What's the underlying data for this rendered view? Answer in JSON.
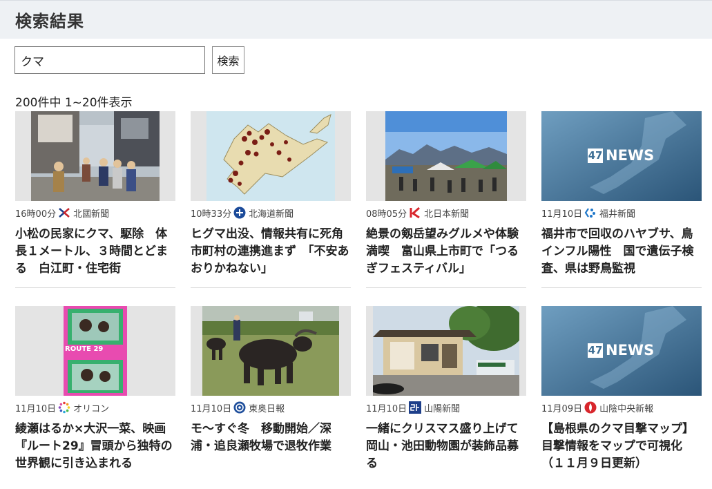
{
  "page": {
    "title": "検索結果"
  },
  "search": {
    "value": "クマ",
    "button_label": "検索"
  },
  "results": {
    "summary": "200件中 1~20件表示",
    "items": [
      {
        "time": "16時00分",
        "source": "北國新聞",
        "title": "小松の民家にクマ、駆除　体長１メートル、３時間とどまる　白江町・住宅街",
        "thumb": "photo-street-crowd",
        "logo": "hokkoku-logo"
      },
      {
        "time": "10時33分",
        "source": "北海道新聞",
        "title": "ヒグマ出没、情報共有に死角　市町村の連携進まず　「不安あおりかねない」",
        "thumb": "map-hokkaido",
        "logo": "hokkaido-shimbun-logo"
      },
      {
        "time": "08時05分",
        "source": "北日本新聞",
        "title": "絶景の剱岳望みグルメや体験満喫　富山県上市町で「つるぎフェスティバル」",
        "thumb": "photo-festival-mountains",
        "logo": "kitanippon-logo"
      },
      {
        "time": "11月10日",
        "source": "福井新聞",
        "title": "福井市で回収のハヤブサ、鳥インフル陽性　国で遺伝子検査、県は野鳥監視",
        "thumb": "47news-placeholder",
        "logo": "fukui-shimbun-logo"
      },
      {
        "time": "11月10日",
        "source": "オリコン",
        "title": "綾瀬はるか×大沢一菜、映画『ルート29』冒頭から独特の世界観に引き込まれる",
        "thumb": "photo-route29",
        "logo": "oricon-logo"
      },
      {
        "time": "11月10日",
        "source": "東奥日報",
        "title": "モ～すぐ冬　移動開始／深浦・追良瀬牧場で退牧作業",
        "thumb": "photo-water-buffalo",
        "logo": "toonippo-logo"
      },
      {
        "time": "11月10日",
        "source": "山陽新聞",
        "title": "一緒にクリスマス盛り上げて　岡山・池田動物園が装飾品募る",
        "thumb": "photo-zoo-building",
        "logo": "sanyo-shimbun-logo"
      },
      {
        "time": "11月09日",
        "source": "山陰中央新報",
        "title": "【島根県のクマ目撃マップ】目撃情報をマップで可視化（１１月９日更新）",
        "thumb": "47news-placeholder",
        "logo": "sanin-chuo-logo"
      }
    ]
  },
  "thumb_text": {
    "news47_num": "47",
    "news47_word": "NEWS",
    "route_label": "ROUTE 29"
  }
}
